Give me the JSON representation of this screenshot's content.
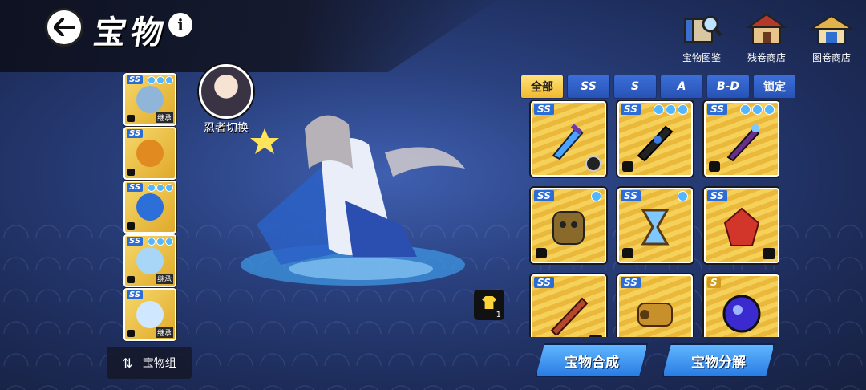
{
  "header": {
    "title": "宝物",
    "info_label": "i"
  },
  "top_right": [
    {
      "label": "宝物图鉴",
      "icon": "book-magnifier-icon"
    },
    {
      "label": "残卷商店",
      "icon": "shop-building-icon"
    },
    {
      "label": "图卷商店",
      "icon": "shop-roof-icon"
    }
  ],
  "left_slots": [
    {
      "rank": "SS",
      "tag": "继承",
      "locked": true
    },
    {
      "rank": "SS",
      "tag": "",
      "locked": true
    },
    {
      "rank": "SS",
      "tag": "",
      "locked": true
    },
    {
      "rank": "SS",
      "tag": "继承",
      "locked": true
    },
    {
      "rank": "SS",
      "tag": "继承",
      "locked": true
    }
  ],
  "character": {
    "switch_label": "忍者切换"
  },
  "skin": {
    "count": "1"
  },
  "set_button": {
    "label": "宝物组"
  },
  "tabs": [
    "全部",
    "SS",
    "S",
    "A",
    "B-D",
    "锁定"
  ],
  "treasures": [
    {
      "rank": "SS",
      "gems": 0,
      "badge": "ring",
      "locked": false,
      "color": "#4aa3ff"
    },
    {
      "rank": "SS",
      "gems": 3,
      "badge": "",
      "locked": true,
      "color": "#222222"
    },
    {
      "rank": "SS",
      "gems": 3,
      "badge": "",
      "locked": true,
      "color": "#6a2d8a"
    },
    {
      "rank": "SS",
      "gems": 1,
      "badge": "",
      "locked": true,
      "color": "#8a6a2a"
    },
    {
      "rank": "SS",
      "gems": 1,
      "badge": "",
      "locked": true,
      "color": "#7ec8ff"
    },
    {
      "rank": "SS",
      "gems": 0,
      "badge": "shirt",
      "locked": false,
      "color": "#d2352a"
    },
    {
      "rank": "SS",
      "gems": 0,
      "badge": "shirt",
      "locked": false,
      "color": "#b5472a"
    },
    {
      "rank": "SS",
      "gems": 0,
      "badge": "",
      "locked": false,
      "color": "#c8902a"
    },
    {
      "rank": "S",
      "gems": 0,
      "badge": "",
      "locked": false,
      "color": "#3a2ad0"
    }
  ],
  "actions": {
    "compose": "宝物合成",
    "decompose": "宝物分解"
  }
}
